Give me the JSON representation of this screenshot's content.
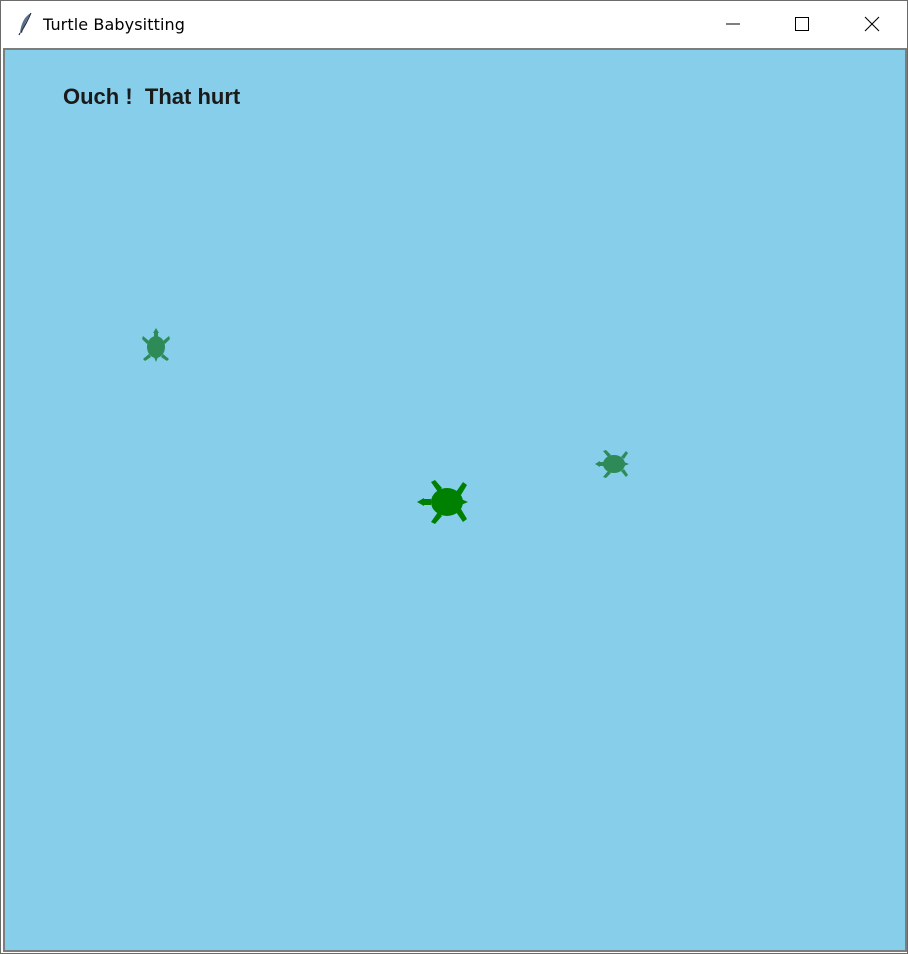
{
  "window": {
    "title": "Turtle Babysitting",
    "app_icon": "feather-icon",
    "controls": [
      "minimize-icon",
      "maximize-icon",
      "close-icon"
    ]
  },
  "game": {
    "status_message": "Ouch !  That hurt",
    "background_color": "#87ceeb",
    "text_color": "#1a1a1a",
    "turtles": [
      {
        "name": "baby-turtle-left",
        "color": "#2e8b57",
        "heading": "up"
      },
      {
        "name": "baby-turtle-right",
        "color": "#2e8b57",
        "heading": "left"
      },
      {
        "name": "player-turtle",
        "color": "#008000",
        "heading": "left"
      }
    ]
  }
}
